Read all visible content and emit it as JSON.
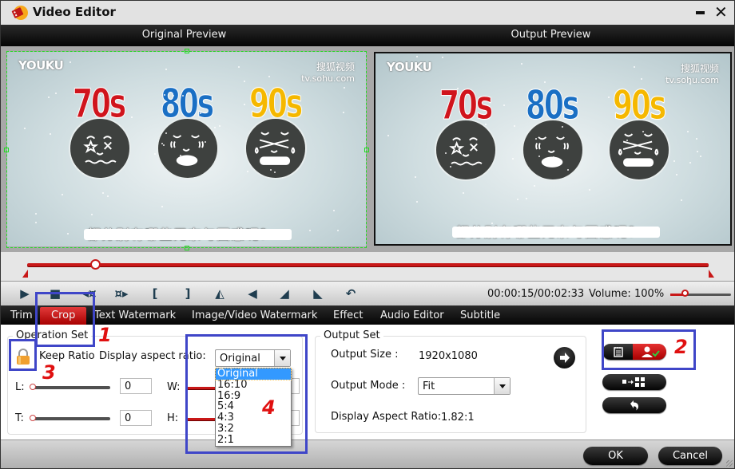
{
  "window": {
    "title": "Video Editor",
    "minimize_icon": "minimize-icon",
    "close_icon": "close-icon"
  },
  "preview": {
    "original_label": "Original Preview",
    "output_label": "Output Preview",
    "video": {
      "watermark_left": "YOUKU",
      "watermark_right_top": "搜狐视频",
      "watermark_right_bottom": "tv.sohu.com",
      "decades": [
        {
          "label": "70s",
          "color": "#d0141c"
        },
        {
          "label": "80s",
          "color": "#1a6fc4"
        },
        {
          "label": "90s",
          "color": "#f5b800"
        }
      ],
      "subtitle": "都分别有哪些无奈与困惑呢？"
    }
  },
  "timeline": {
    "progress": 0.1,
    "current_time": "00:00:15",
    "total_time": "00:02:33"
  },
  "controls": {
    "buttons": [
      "play-icon",
      "stop-icon",
      "step-back-icon",
      "step-forward-icon",
      "mark-in-icon",
      "mark-out-icon",
      "flip-horizontal-icon",
      "flip-vertical-icon",
      "rotate-left-icon",
      "rotate-right-icon",
      "undo-icon"
    ],
    "time_display": "00:00:15/00:02:33",
    "volume_label": "Volume:",
    "volume_value": "100%",
    "volume_level": 0.25
  },
  "tabs": [
    {
      "label": "Trim",
      "active": false
    },
    {
      "label": "Crop",
      "active": true
    },
    {
      "label": "Text Watermark",
      "active": false
    },
    {
      "label": "Image/Video Watermark",
      "active": false
    },
    {
      "label": "Effect",
      "active": false
    },
    {
      "label": "Audio Editor",
      "active": false
    },
    {
      "label": "Subtitle",
      "active": false
    }
  ],
  "operation_set": {
    "title": "Operation Set",
    "keep_ratio_label": "Keep Ratio",
    "display_aspect_label": "Display aspect ratio:",
    "aspect_selected": "Original",
    "aspect_options": [
      "Original",
      "16:10",
      "16:9",
      "5:4",
      "4:3",
      "3:2",
      "2:1"
    ],
    "left_label": "L:",
    "left_value": "0",
    "top_label": "T:",
    "top_value": "0",
    "width_label": "W:",
    "height_label": "H:"
  },
  "output_set": {
    "title": "Output Set",
    "size_label": "Output Size :",
    "size_value": "1920x1080",
    "mode_label": "Output Mode :",
    "mode_value": "Fit",
    "aspect_label": "Display Aspect Ratio:",
    "aspect_value": "1.82:1"
  },
  "side_buttons": [
    "notes-user-toggle",
    "apply-to-all",
    "reset"
  ],
  "footer": {
    "ok_label": "OK",
    "cancel_label": "Cancel"
  },
  "annotations": [
    "1",
    "2",
    "3",
    "4"
  ]
}
